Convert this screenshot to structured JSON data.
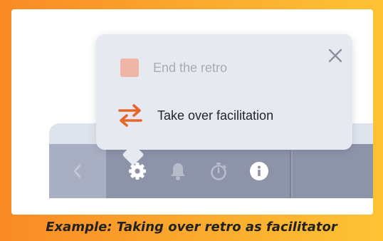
{
  "popup": {
    "end_retro_label": "End the retro",
    "take_over_label": "Take over facilitation"
  },
  "toolbar": {
    "icons": [
      "chevron-left-icon",
      "gear-icon",
      "bell-icon",
      "stopwatch-icon",
      "info-icon"
    ]
  },
  "caption": "Example: Taking over retro as facilitator",
  "colors": {
    "accent": "#e8652a",
    "toolbar": "#8d93a9",
    "popup_bg": "#e6e9ef",
    "end_square": "#efb5a7"
  }
}
